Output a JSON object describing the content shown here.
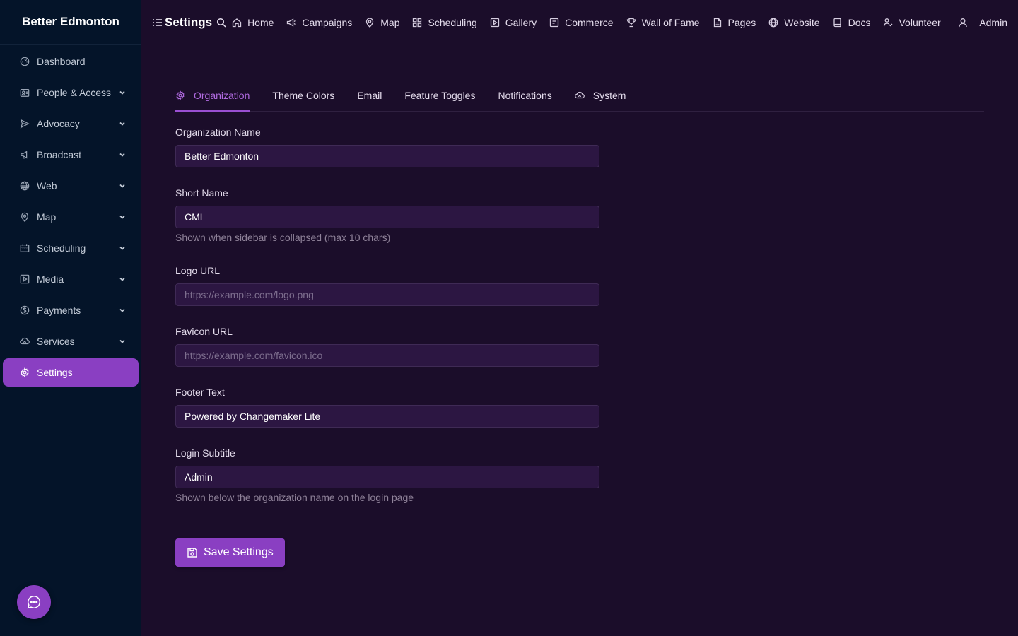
{
  "sidebar": {
    "brand": "Better Edmonton",
    "items": [
      {
        "label": "Dashboard",
        "icon": "dashboard-icon",
        "has_chevron": false
      },
      {
        "label": "People & Access",
        "icon": "people-icon",
        "has_chevron": true
      },
      {
        "label": "Advocacy",
        "icon": "send-icon",
        "has_chevron": true
      },
      {
        "label": "Broadcast",
        "icon": "megaphone-icon",
        "has_chevron": true
      },
      {
        "label": "Web",
        "icon": "globe-icon",
        "has_chevron": true
      },
      {
        "label": "Map",
        "icon": "map-pin-icon",
        "has_chevron": true
      },
      {
        "label": "Scheduling",
        "icon": "calendar-icon",
        "has_chevron": true
      },
      {
        "label": "Media",
        "icon": "media-icon",
        "has_chevron": true
      },
      {
        "label": "Payments",
        "icon": "dollar-icon",
        "has_chevron": true
      },
      {
        "label": "Services",
        "icon": "cloud-icon",
        "has_chevron": true
      },
      {
        "label": "Settings",
        "icon": "gear-icon",
        "has_chevron": false,
        "active": true
      }
    ]
  },
  "topbar": {
    "title": "Settings",
    "links": [
      {
        "label": "Home",
        "icon": "home-icon"
      },
      {
        "label": "Campaigns",
        "icon": "megaphone-icon"
      },
      {
        "label": "Map",
        "icon": "map-pin-icon"
      },
      {
        "label": "Scheduling",
        "icon": "grid-icon"
      },
      {
        "label": "Gallery",
        "icon": "play-square-icon"
      },
      {
        "label": "Commerce",
        "icon": "commerce-icon"
      },
      {
        "label": "Wall of Fame",
        "icon": "trophy-icon"
      },
      {
        "label": "Pages",
        "icon": "file-icon"
      },
      {
        "label": "Website",
        "icon": "globe-icon"
      },
      {
        "label": "Docs",
        "icon": "book-icon"
      },
      {
        "label": "Volunteer",
        "icon": "volunteer-icon"
      }
    ],
    "user_label": "Admin"
  },
  "tabs": [
    {
      "label": "Organization",
      "active": true,
      "icon": "gear-icon"
    },
    {
      "label": "Theme Colors",
      "active": false
    },
    {
      "label": "Email",
      "active": false
    },
    {
      "label": "Feature Toggles",
      "active": false
    },
    {
      "label": "Notifications",
      "active": false
    },
    {
      "label": "System",
      "active": false,
      "icon": "cloud-icon"
    }
  ],
  "form": {
    "org_name": {
      "label": "Organization Name",
      "value": "Better Edmonton"
    },
    "short_name": {
      "label": "Short Name",
      "value": "CML",
      "hint": "Shown when sidebar is collapsed (max 10 chars)"
    },
    "logo_url": {
      "label": "Logo URL",
      "value": "",
      "placeholder": "https://example.com/logo.png"
    },
    "favicon_url": {
      "label": "Favicon URL",
      "value": "",
      "placeholder": "https://example.com/favicon.ico"
    },
    "footer_text": {
      "label": "Footer Text",
      "value": "Powered by Changemaker Lite"
    },
    "login_subtitle": {
      "label": "Login Subtitle",
      "value": "Admin",
      "hint": "Shown below the organization name on the login page"
    }
  },
  "save_button": {
    "label": "Save Settings"
  },
  "colors": {
    "accent": "#8a3fc2",
    "sidebar_bg": "#041429",
    "main_bg": "#1b0d2a",
    "input_bg": "#2c1642"
  }
}
